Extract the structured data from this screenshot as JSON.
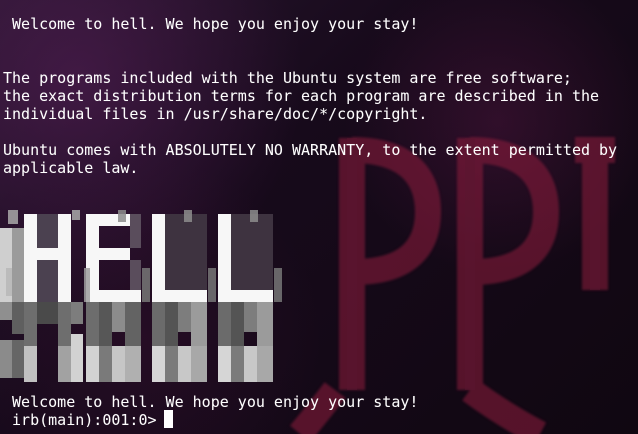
{
  "terminal": {
    "welcome_top": " Welcome to hell. We hope you enjoy your stay!",
    "motd_line_1": "The programs included with the Ubuntu system are free software;",
    "motd_line_2": "the exact distribution terms for each program are described in the",
    "motd_line_3": "individual files in /usr/share/doc/*/copyright.",
    "warranty_line_1": "Ubuntu comes with ABSOLUTELY NO WARRANTY, to the extent permitted by",
    "warranty_line_2": "applicable law.",
    "welcome_bottom": " Welcome to hell. We hope you enjoy your stay!",
    "prompt": " irb(main):001:0> "
  },
  "banner": {
    "text": "HELL"
  },
  "colors": {
    "background": "#1a0f1c",
    "text": "#ffffff",
    "accent": "#8f1d3c"
  },
  "icons": {
    "background": "occult-symbol-icon",
    "cursor": "block-cursor-icon"
  }
}
